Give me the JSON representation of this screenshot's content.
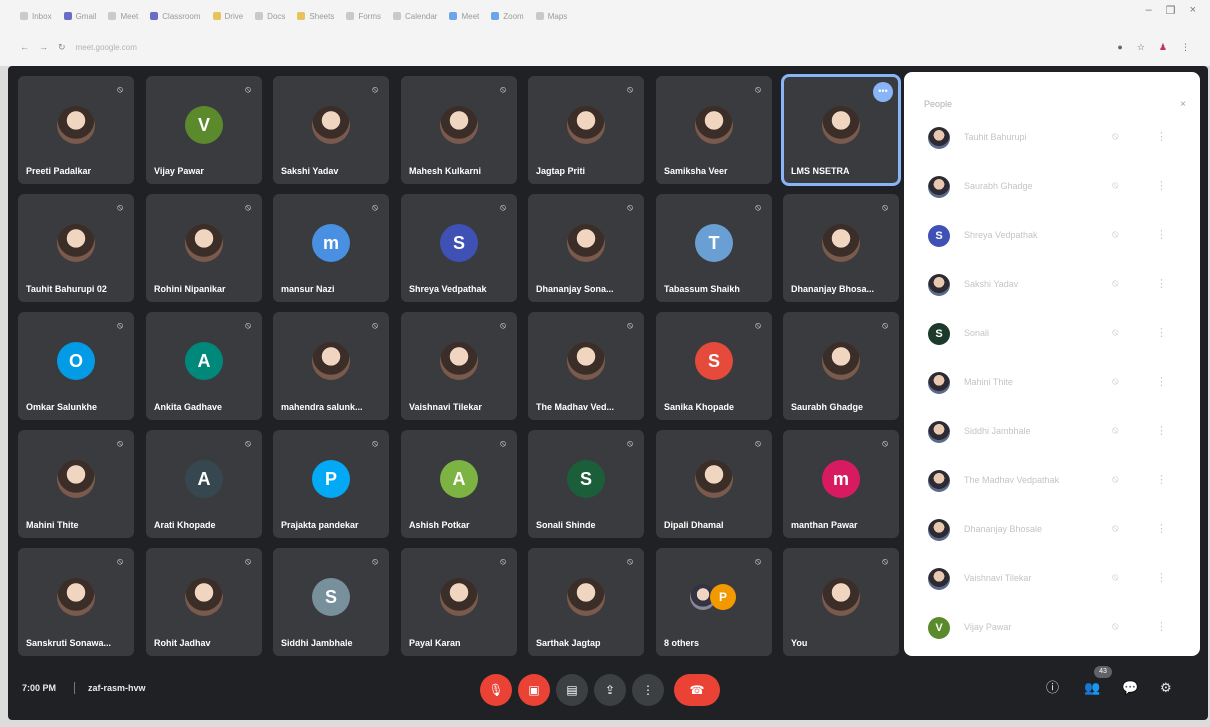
{
  "participants_grid": [
    {
      "name": "Preeti Padalkar",
      "avatar": "photo"
    },
    {
      "name": "Vijay Pawar",
      "avatar": "letter",
      "letter": "V",
      "color": "#5a8a2c"
    },
    {
      "name": "Sakshi Yadav",
      "avatar": "photo"
    },
    {
      "name": "Mahesh Kulkarni",
      "avatar": "photo"
    },
    {
      "name": "Jagtap Priti",
      "avatar": "photo"
    },
    {
      "name": "Samiksha Veer",
      "avatar": "photo"
    },
    {
      "name": "LMS NSETRA",
      "avatar": "photo",
      "active": true
    },
    {
      "name": "Tauhit Bahurupi 02",
      "avatar": "photo"
    },
    {
      "name": "Rohini Nipanikar",
      "avatar": "photo"
    },
    {
      "name": "mansur Nazi",
      "avatar": "letter",
      "letter": "m",
      "color": "#4a90e2"
    },
    {
      "name": "Shreya Vedpathak",
      "avatar": "letter",
      "letter": "S",
      "color": "#3f51b5"
    },
    {
      "name": "Dhananjay Sona...",
      "avatar": "photo"
    },
    {
      "name": "Tabassum Shaikh",
      "avatar": "letter",
      "letter": "T",
      "color": "#6a9fd4"
    },
    {
      "name": "Dhananjay Bhosa...",
      "avatar": "photo"
    },
    {
      "name": "Omkar Salunkhe",
      "avatar": "letter",
      "letter": "O",
      "color": "#039be5"
    },
    {
      "name": "Ankita Gadhave",
      "avatar": "letter",
      "letter": "A",
      "color": "#00897b"
    },
    {
      "name": "mahendra salunk...",
      "avatar": "photo"
    },
    {
      "name": "Vaishnavi Tilekar",
      "avatar": "photo"
    },
    {
      "name": "The Madhav Ved...",
      "avatar": "photo"
    },
    {
      "name": "Sanika Khopade",
      "avatar": "letter",
      "letter": "S",
      "color": "#e64a3b"
    },
    {
      "name": "Saurabh Ghadge",
      "avatar": "photo"
    },
    {
      "name": "Mahini Thite",
      "avatar": "photo"
    },
    {
      "name": "Arati Khopade",
      "avatar": "letter",
      "letter": "A",
      "color": "#37474f"
    },
    {
      "name": "Prajakta pandekar",
      "avatar": "letter",
      "letter": "P",
      "color": "#03a9f4"
    },
    {
      "name": "Ashish Potkar",
      "avatar": "letter",
      "letter": "A",
      "color": "#7cb342"
    },
    {
      "name": "Sonali Shinde",
      "avatar": "letter",
      "letter": "S",
      "color": "#1b5e3a"
    },
    {
      "name": "Dipali Dhamal",
      "avatar": "photo"
    },
    {
      "name": "manthan Pawar",
      "avatar": "letter",
      "letter": "m",
      "color": "#d81b60"
    },
    {
      "name": "Sanskruti Sonawa...",
      "avatar": "photo"
    },
    {
      "name": "Rohit Jadhav",
      "avatar": "photo"
    },
    {
      "name": "Siddhi Jambhale",
      "avatar": "letter",
      "letter": "S",
      "color": "#78909c"
    },
    {
      "name": "Payal Karan",
      "avatar": "photo"
    },
    {
      "name": "Sarthak Jagtap",
      "avatar": "photo"
    },
    {
      "name": "8 others",
      "avatar": "others",
      "letter": "P"
    },
    {
      "name": "You",
      "avatar": "photo"
    }
  ],
  "panel": {
    "title": "People",
    "close_icon": "×",
    "rows": [
      {
        "name": "Tauhit Bahurupi",
        "avatar": "photo"
      },
      {
        "name": "Saurabh Ghadge",
        "avatar": "photo"
      },
      {
        "name": "Shreya Vedpathak",
        "avatar": "letter",
        "letter": "S",
        "color": "#3f51b5"
      },
      {
        "name": "Sakshi Yadav",
        "avatar": "photo"
      },
      {
        "name": "Sonali",
        "avatar": "letter",
        "letter": "S",
        "color": "#1b3a2a"
      },
      {
        "name": "Mahini Thite",
        "avatar": "photo"
      },
      {
        "name": "Siddhi Jambhale",
        "avatar": "photo"
      },
      {
        "name": "The Madhav Vedpathak",
        "avatar": "photo"
      },
      {
        "name": "Dhananjay Bhosale",
        "avatar": "photo"
      },
      {
        "name": "Vaishnavi Tilekar",
        "avatar": "photo"
      },
      {
        "name": "Vijay Pawar",
        "avatar": "letter",
        "letter": "V",
        "color": "#5a8a2c"
      }
    ]
  },
  "bottom_bar": {
    "time": "7:00 PM",
    "meeting_code": "zaf-rasm-hvw",
    "participant_count": "43",
    "controls": {
      "mic_icon": "🎙",
      "cam_icon": "▣",
      "captions_icon": "▤",
      "present_icon": "⇪",
      "more_icon": "⋮",
      "end_call_icon": "☎"
    },
    "right": {
      "info_icon": "ⓘ",
      "people_icon": "👥",
      "chat_icon": "💬",
      "activities_icon": "⚙"
    }
  },
  "browser": {
    "url": "meet.google.com",
    "tabs": [
      "Inbox",
      "Gmail",
      "Meet",
      "Classroom",
      "Drive",
      "Docs",
      "Sheets",
      "Forms",
      "Calendar",
      "Meet",
      "Zoom",
      "Maps"
    ]
  }
}
